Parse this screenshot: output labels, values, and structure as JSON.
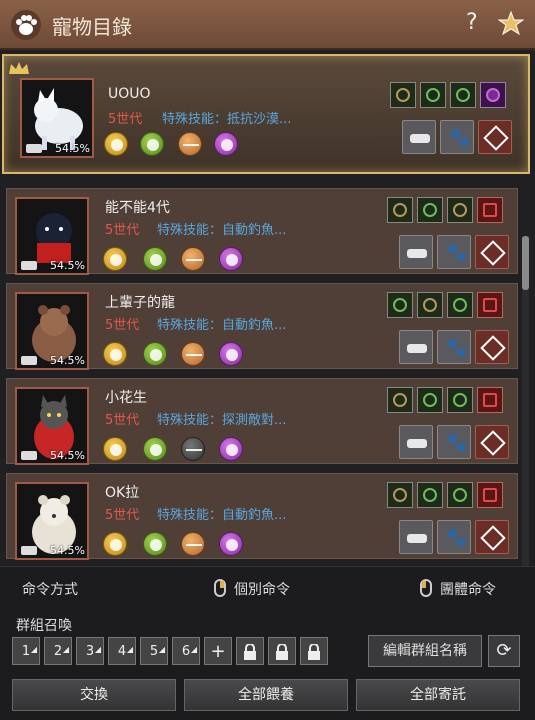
{
  "window": {
    "title": "寵物目錄",
    "help": "?"
  },
  "pets": [
    {
      "name": "UOUO",
      "gen": "5世代",
      "skill": "特殊技能：抵抗沙漠...",
      "hunger": "54.5%",
      "selected": true,
      "circles": [
        "y",
        "g",
        "o",
        "p"
      ]
    },
    {
      "name": "能不能4代",
      "gen": "5世代",
      "skill": "特殊技能：自動釣魚...",
      "hunger": "54.5%",
      "circles": [
        "y",
        "g",
        "o",
        "p"
      ]
    },
    {
      "name": "上輩子的龍",
      "gen": "5世代",
      "skill": "特殊技能：自動釣魚...",
      "hunger": "54.5%",
      "circles": [
        "y",
        "g",
        "o",
        "p"
      ]
    },
    {
      "name": "小花生",
      "gen": "5世代",
      "skill": "特殊技能：探測敵對...",
      "hunger": "54.5%",
      "circles": [
        "y",
        "g",
        "d",
        "p"
      ]
    },
    {
      "name": "OK拉",
      "gen": "5世代",
      "skill": "特殊技能：自動釣魚...",
      "hunger": "54.5%",
      "circles": [
        "y",
        "g",
        "o",
        "p"
      ]
    }
  ],
  "footer": {
    "command_mode": "命令方式",
    "individual": "個別命令",
    "group_cmd": "團體命令",
    "group_summon": "群組召喚",
    "groups": [
      "1",
      "2",
      "3",
      "4",
      "5",
      "6",
      "+"
    ],
    "edit_group": "編輯群組名稱",
    "exchange": "交換",
    "feed_all": "全部餵養",
    "store_all": "全部寄託"
  },
  "colors": {
    "accent": "#d8b96a",
    "generation": "#e0584a",
    "skill": "#5aa6dd"
  }
}
